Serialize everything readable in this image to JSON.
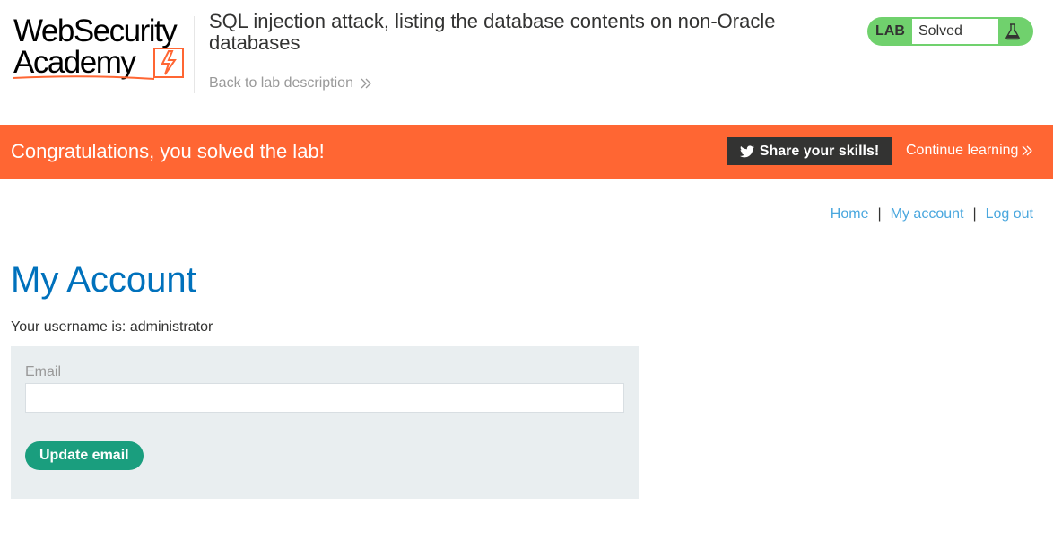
{
  "header": {
    "logo": {
      "line1": "WebSecurity",
      "line2": "Academy"
    },
    "lab_title": "SQL injection attack, listing the database contents on non-Oracle databases",
    "back_link": "Back to lab description",
    "status": {
      "badge": "LAB",
      "text": "Solved",
      "color": "#70d16d"
    }
  },
  "banner": {
    "message": "Congratulations, you solved the lab!",
    "share_label": "Share your skills!",
    "continue_label": "Continue learning",
    "color": "#ff6633"
  },
  "nav": {
    "items": [
      {
        "label": "Home"
      },
      {
        "label": "My account"
      },
      {
        "label": "Log out"
      }
    ],
    "separator": "|"
  },
  "main": {
    "heading": "My Account",
    "username_line": "Your username is: administrator",
    "email_label": "Email",
    "email_value": "",
    "update_button": "Update email"
  },
  "icons": {
    "share": "twitter-icon",
    "back": "double-chevron-right-icon",
    "continue": "double-chevron-right-icon",
    "status": "flask-icon",
    "logo": "lightning-bolt-icon"
  }
}
